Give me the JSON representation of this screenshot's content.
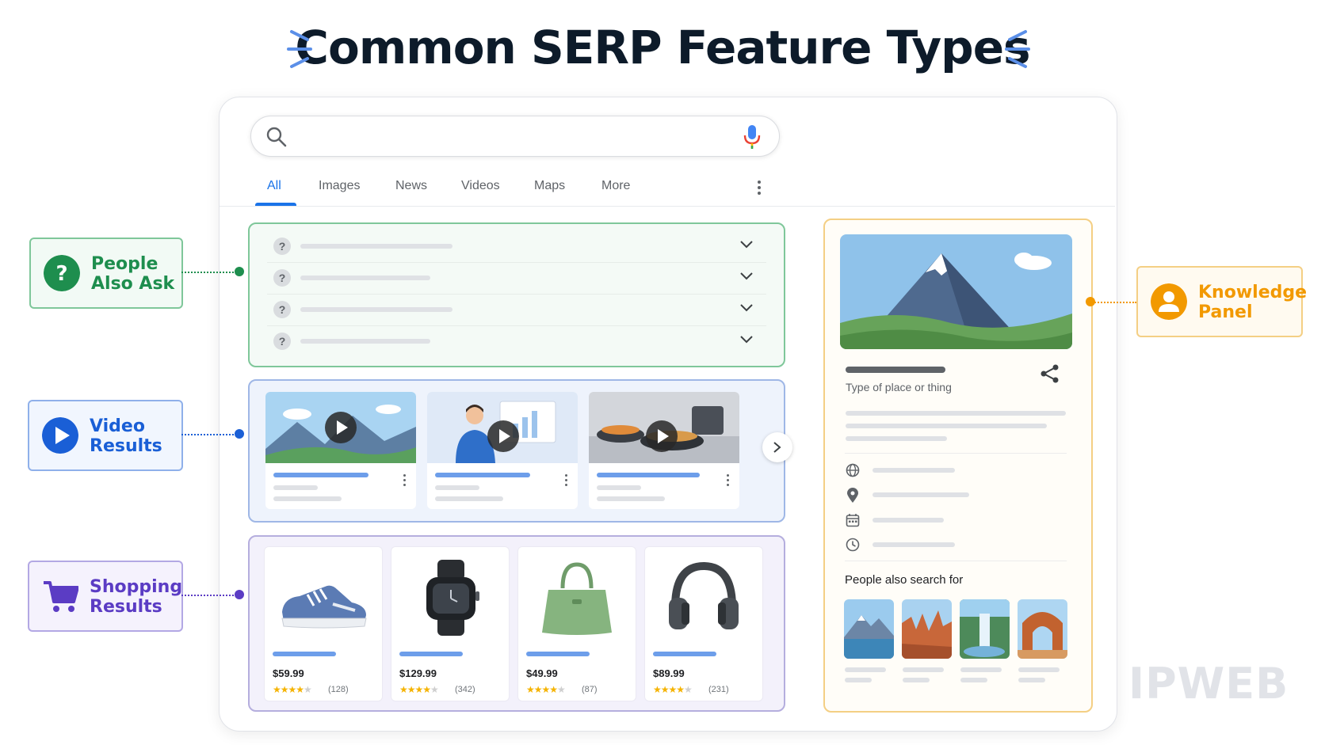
{
  "title": "Common SERP Feature Types",
  "search": {
    "icon": "search-icon",
    "mic_icon": "microphone-icon"
  },
  "tabs": [
    {
      "label": "All",
      "active": true
    },
    {
      "label": "Images"
    },
    {
      "label": "News"
    },
    {
      "label": "Videos"
    },
    {
      "label": "Maps"
    },
    {
      "label": "More"
    }
  ],
  "people_also_ask": {
    "rows": 4,
    "question_icon": "?"
  },
  "video_results": {
    "cards": 3
  },
  "shopping_results": {
    "products": [
      {
        "item": "sneaker",
        "price": "$59.99",
        "stars": 4.5,
        "count": "(128)"
      },
      {
        "item": "smartwatch",
        "price": "$129.99",
        "stars": 4.5,
        "count": "(342)"
      },
      {
        "item": "handbag",
        "price": "$49.99",
        "stars": 4.5,
        "count": "(87)"
      },
      {
        "item": "headphones",
        "price": "$89.99",
        "stars": 4.5,
        "count": "(231)"
      }
    ]
  },
  "knowledge_panel": {
    "type_text": "Type of place or thing",
    "info_icons": [
      "globe-icon",
      "location-pin-icon",
      "calendar-icon",
      "clock-icon"
    ],
    "people_also_search_for": "People also search for",
    "related_thumbs": [
      "mountain-lake",
      "red-rock-canyon",
      "waterfall",
      "rock-arch"
    ]
  },
  "labels": {
    "people_also_ask": "People\nAlso Ask",
    "video_results": "Video\nResults",
    "shopping_results": "Shopping\nResults",
    "knowledge_panel": "Knowledge\nPanel"
  },
  "colors": {
    "green": "#1e8e4e",
    "blue": "#1a5fd6",
    "purple": "#5b3cc4",
    "orange": "#f29900",
    "google_blue": "#1a73e8"
  },
  "watermark": "IPWEB"
}
